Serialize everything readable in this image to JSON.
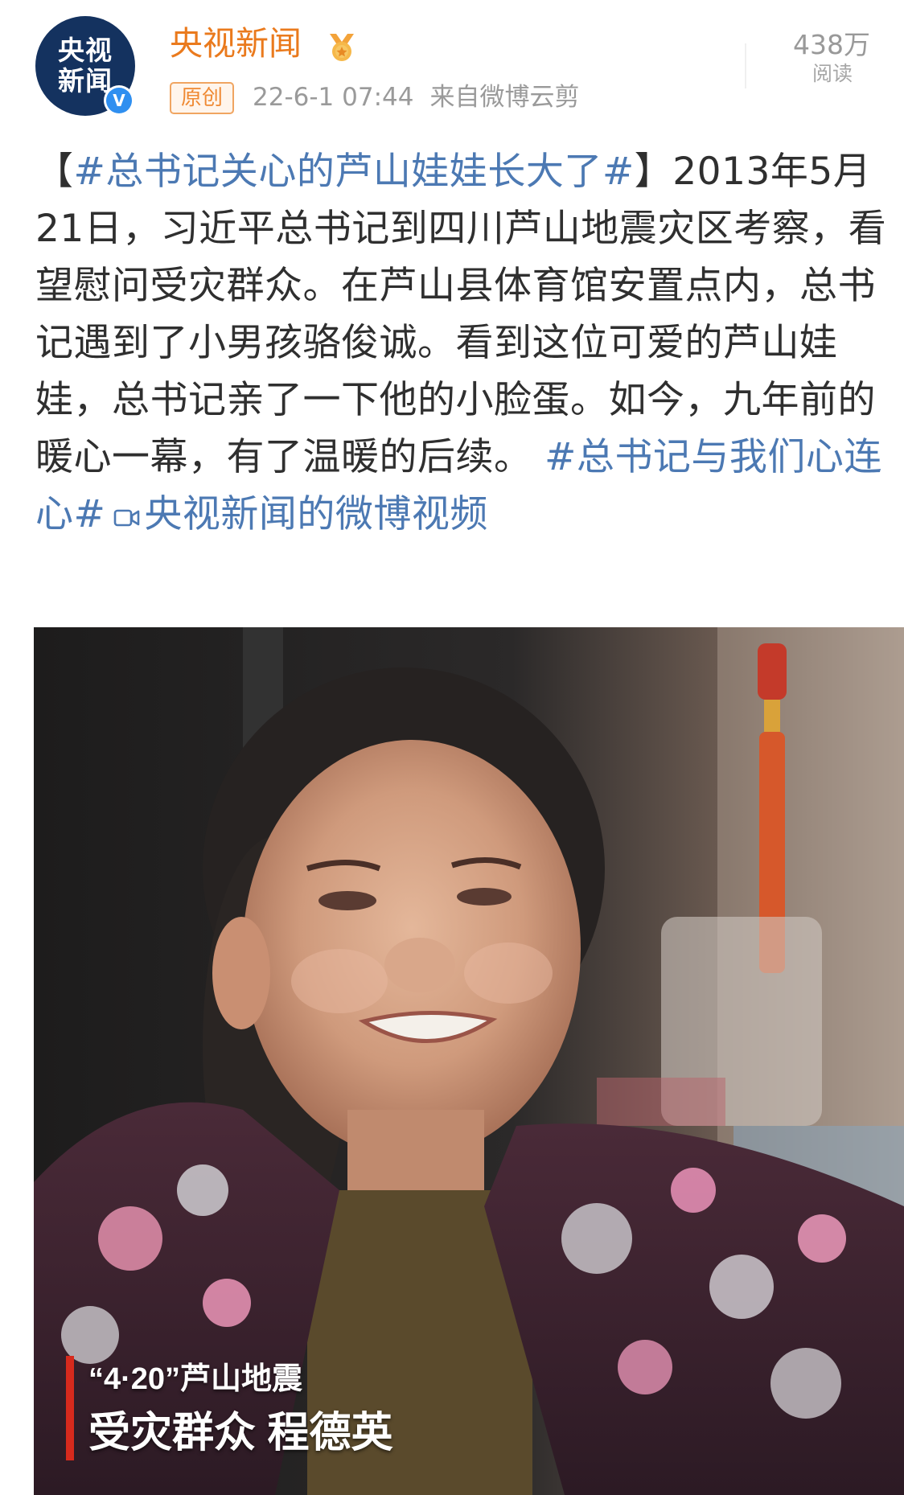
{
  "header": {
    "avatar_text_line1": "央视",
    "avatar_text_line2": "新闻",
    "avatar_at": "@",
    "verified_mark": "V",
    "account_name": "央视新闻",
    "medal_icon": "medal-icon",
    "original_badge": "原创",
    "timestamp": "22-6-1 07:44",
    "source": "来自微博云剪",
    "views_count": "438万",
    "views_label": "阅读"
  },
  "post": {
    "bracket_open": "【",
    "topic_title": "#总书记关心的芦山娃娃长大了#",
    "bracket_close": "】",
    "body": "2013年5月21日，习近平总书记到四川芦山地震灾区考察，看望慰问受灾群众。在芦山县体育馆安置点内，总书记遇到了小男孩骆俊诚。看到这位可爱的芦山娃娃，总书记亲了一下他的小脸蛋。如今，九年前的暖心一幕，有了温暖的后续。",
    "topic_tag": "#总书记与我们心连心#",
    "video_link_text": "央视新闻的微博视频",
    "video_link_icon": "video-link-icon"
  },
  "video": {
    "caption_line1": "“4·20”芦山地震",
    "caption_line2": "受灾群众 程德英"
  },
  "colors": {
    "account_name": "#ea7a1d",
    "link": "#4c79b3",
    "meta_gray": "#9a9a9a",
    "caption_bar": "#d62a1d",
    "avatar_bg": "#14325f",
    "verified": "#2f8ff0"
  }
}
